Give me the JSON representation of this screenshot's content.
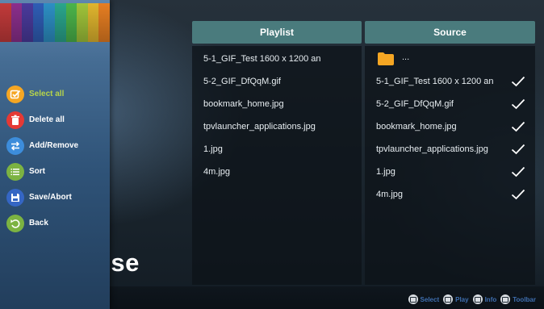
{
  "sidebar": {
    "stripe_colors": [
      "#c23a3a",
      "#8b2f8c",
      "#4a3a9c",
      "#2f5db5",
      "#2d8fc4",
      "#2aa58c",
      "#4bb44a",
      "#a0c43a",
      "#e0b52e",
      "#e67e22"
    ],
    "menu": [
      {
        "label": "Select all",
        "icon": "select-all-icon",
        "color": "#f5a623",
        "active": true
      },
      {
        "label": "Delete all",
        "icon": "trash-icon",
        "color": "#e53935",
        "active": false
      },
      {
        "label": "Add/Remove",
        "icon": "swap-icon",
        "color": "#3d8ddb",
        "active": false
      },
      {
        "label": "Sort",
        "icon": "sort-list-icon",
        "color": "#7cb342",
        "active": false
      },
      {
        "label": "Save/Abort",
        "icon": "save-icon",
        "color": "#3566c4",
        "active": false
      },
      {
        "label": "Back",
        "icon": "back-icon",
        "color": "#7cb342",
        "active": false
      }
    ]
  },
  "background_text": "ose",
  "playlist": {
    "header": "Playlist",
    "items": [
      "5-1_GIF_Test 1600 x 1200 an",
      "5-2_GIF_DfQqM.gif",
      "bookmark_home.jpg",
      "tpvlauncher_applications.jpg",
      "1.jpg",
      "4m.jpg"
    ]
  },
  "source": {
    "header": "Source",
    "folder_label": "...",
    "items": [
      {
        "name": "5-1_GIF_Test 1600 x 1200 an",
        "checked": true
      },
      {
        "name": "5-2_GIF_DfQqM.gif",
        "checked": true
      },
      {
        "name": "bookmark_home.jpg",
        "checked": true
      },
      {
        "name": "tpvlauncher_applications.jpg",
        "checked": true
      },
      {
        "name": "1.jpg",
        "checked": true
      },
      {
        "name": "4m.jpg",
        "checked": true
      }
    ]
  },
  "hints": [
    {
      "label": "Select",
      "icon": "select-key-icon"
    },
    {
      "label": "Play",
      "icon": "play-key-icon"
    },
    {
      "label": "Info",
      "icon": "info-key-icon"
    },
    {
      "label": "Toolbar",
      "icon": "toolbar-key-icon"
    }
  ],
  "colors": {
    "header": "#4a7b7d",
    "active_menu": "#b7d44a",
    "hint_text": "#3f6fb0"
  }
}
